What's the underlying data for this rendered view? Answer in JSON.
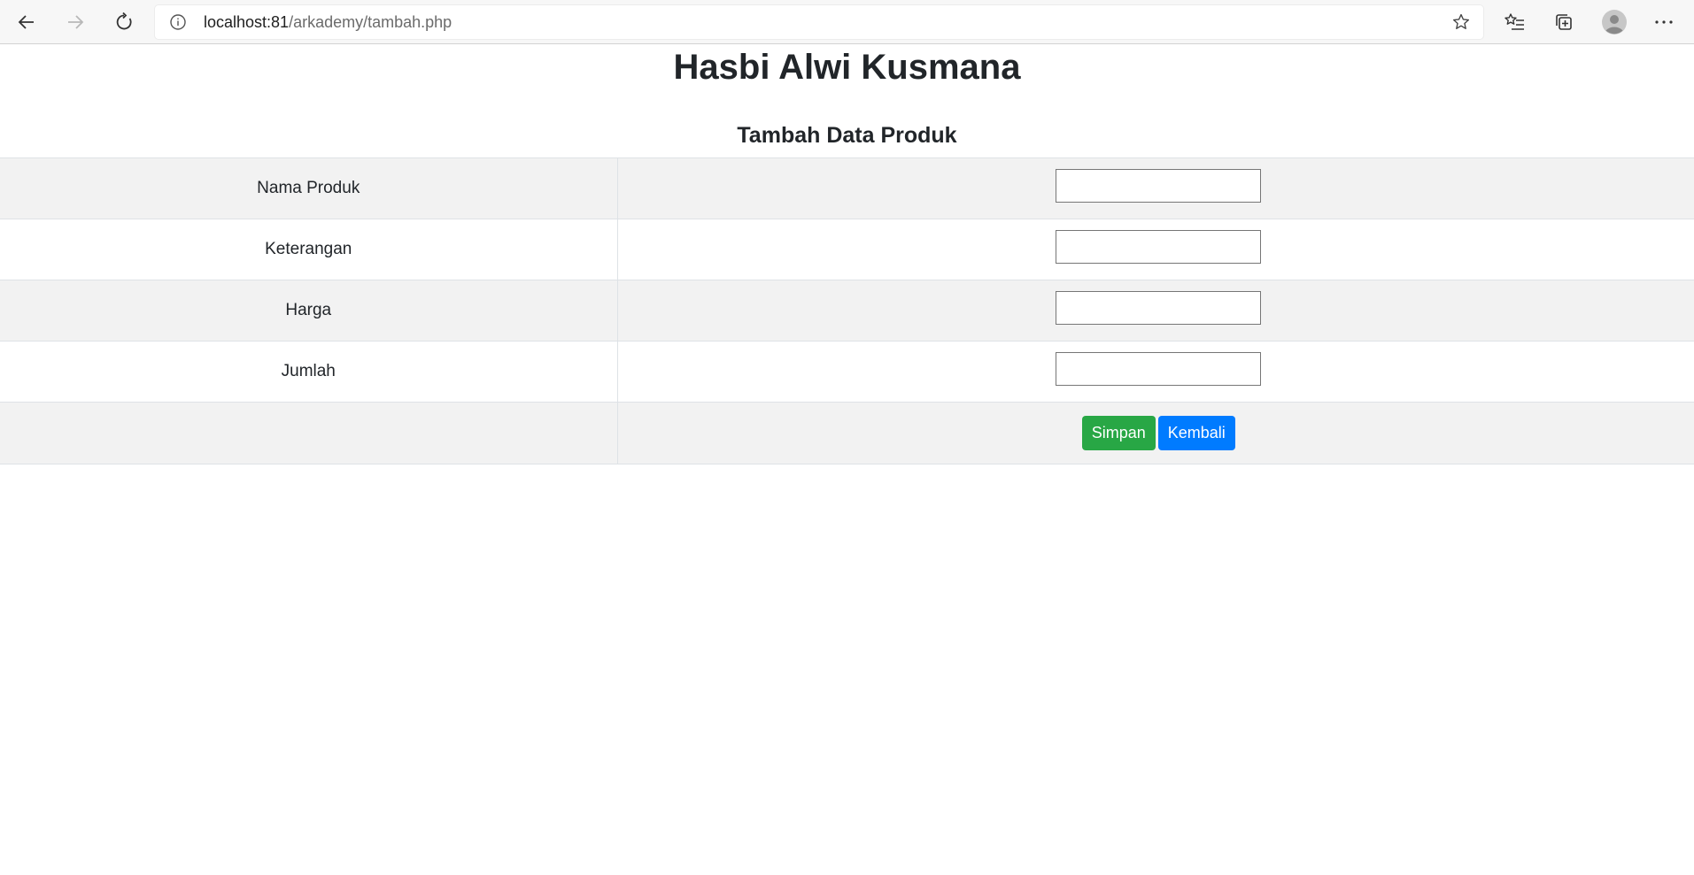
{
  "browser": {
    "url_host": "localhost:81",
    "url_path": "/arkademy/tambah.php"
  },
  "page": {
    "title": "Hasbi Alwi Kusmana",
    "subtitle": "Tambah Data Produk"
  },
  "form": {
    "fields": [
      {
        "label": "Nama Produk",
        "value": ""
      },
      {
        "label": "Keterangan",
        "value": ""
      },
      {
        "label": "Harga",
        "value": ""
      },
      {
        "label": "Jumlah",
        "value": ""
      }
    ],
    "save_label": "Simpan",
    "back_label": "Kembali"
  },
  "colors": {
    "save_button": "#28a745",
    "back_button": "#007bff",
    "stripe": "#f2f2f2"
  }
}
